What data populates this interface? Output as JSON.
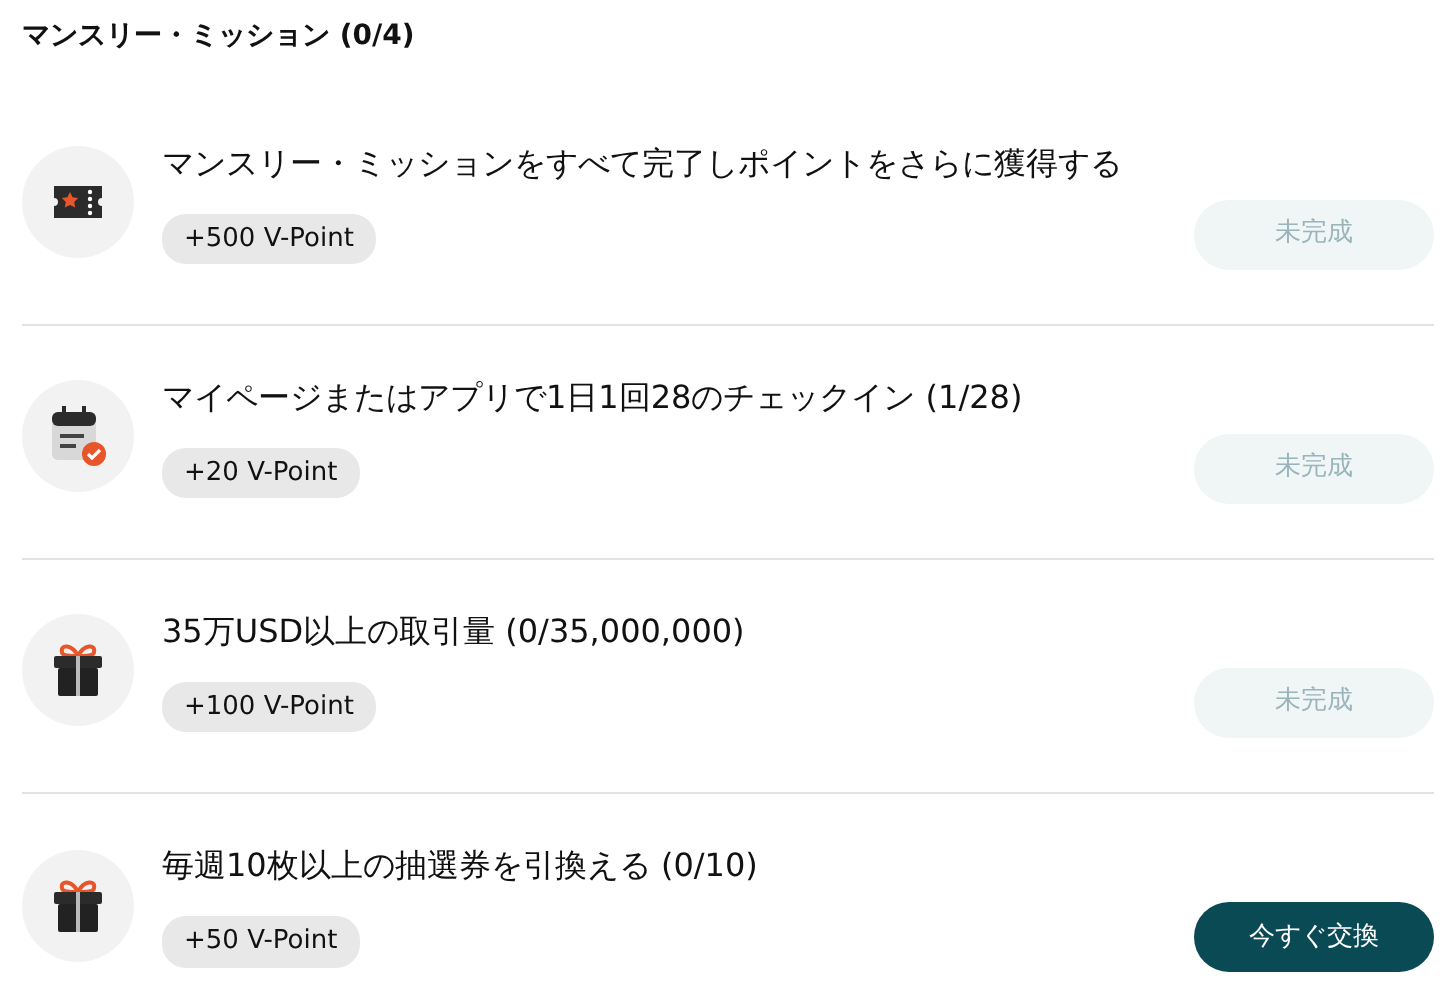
{
  "header": {
    "title": "マンスリー・ミッション (0/4)"
  },
  "missions": [
    {
      "kind": "ticket",
      "title": "マンスリー・ミッションをすべて完了しポイントをさらに獲得する",
      "reward": "+500 V-Point",
      "button": {
        "label": "未完成",
        "disabled": true
      }
    },
    {
      "kind": "calendar",
      "title": "マイページまたはアプリで1日1回28のチェックイン (1/28)",
      "reward": "+20 V-Point",
      "button": {
        "label": "未完成",
        "disabled": true
      }
    },
    {
      "kind": "gift",
      "title": "35万USD以上の取引量 (0/35,000,000)",
      "reward": "+100 V-Point",
      "button": {
        "label": "未完成",
        "disabled": true
      }
    },
    {
      "kind": "gift",
      "title": "毎週10枚以上の抽選券を引換える (0/10)",
      "reward": "+50 V-Point",
      "button": {
        "label": "今すぐ交換",
        "disabled": false
      }
    }
  ]
}
